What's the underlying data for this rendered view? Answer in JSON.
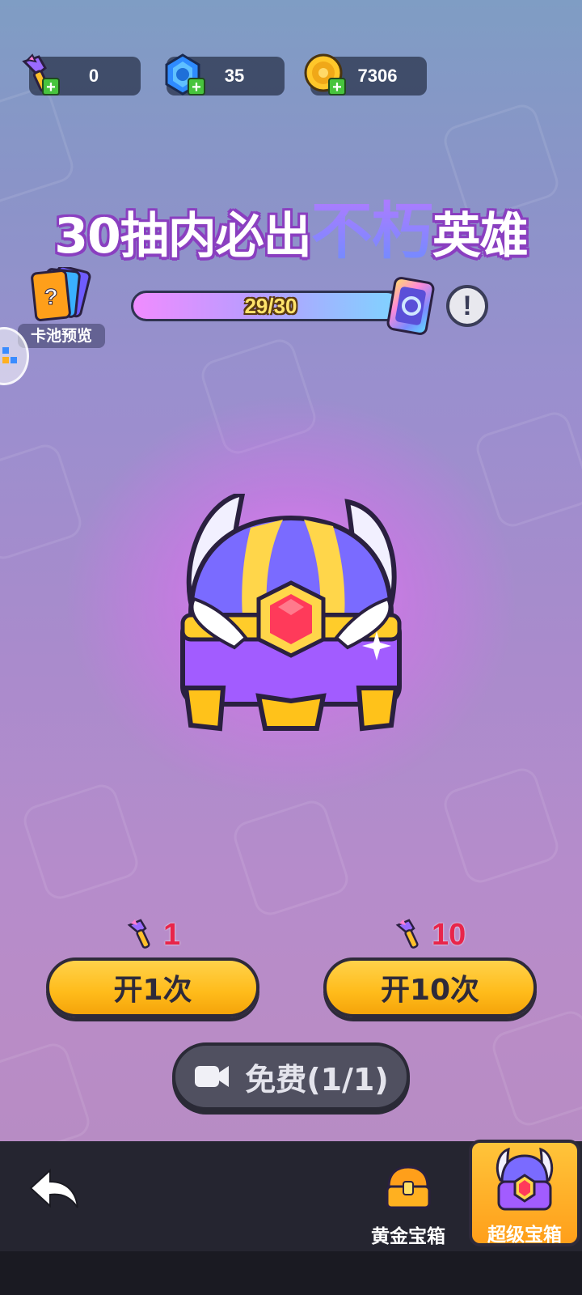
{
  "resources": {
    "keys": "0",
    "gems": "35",
    "coins": "7306"
  },
  "title": {
    "prefix": "30抽内必出",
    "highlight": "不朽",
    "suffix": "英雄"
  },
  "pool_preview": {
    "label": "卡池预览"
  },
  "progress": {
    "text": "29/30",
    "current": 29,
    "total": 30
  },
  "draw_options": [
    {
      "cost": "1",
      "label": "开1次"
    },
    {
      "cost": "10",
      "label": "开10次"
    }
  ],
  "free": {
    "label": "免费(1/1)"
  },
  "tabs": [
    {
      "label": "黄金宝箱",
      "selected": false
    },
    {
      "label": "超级宝箱",
      "selected": true
    }
  ],
  "colors": {
    "button_yellow": "#ffbb1a",
    "cost_red": "#e8254a",
    "title_purple": "#8a3fc0"
  }
}
